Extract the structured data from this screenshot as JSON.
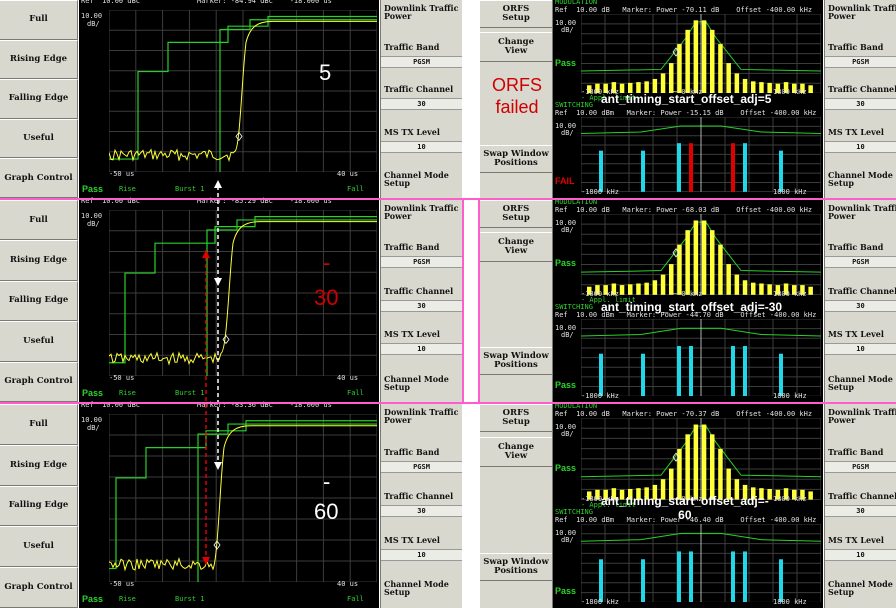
{
  "left": {
    "panels": [
      {
        "buttons": [
          "Full",
          "Rising Edge",
          "Falling Edge",
          "Useful",
          "Graph Control"
        ],
        "ref": "Ref  10.00 dBc",
        "marker": "Marker: -84.94 dBc    -18.000 us",
        "scale": "10.00",
        "scale_unit": "dB/",
        "x_left": "-50 us",
        "x_right": "40 us",
        "footer_pass": "Pass",
        "footer_rise": "Rise",
        "footer_burst": "Burst 1",
        "footer_fall": "Fall",
        "annotation": "5",
        "right_labels": {
          "dl_power": "Downlink Traffic\nPower",
          "traffic_band": "Traffic Band",
          "traffic_band_value": "PGSM",
          "traffic_channel": "Traffic Channel",
          "traffic_channel_value": "30",
          "ms_tx_level": "MS TX Level",
          "ms_tx_level_value": "10",
          "channel_mode": "Channel Mode\nSetup"
        }
      },
      {
        "buttons": [
          "Full",
          "Rising Edge",
          "Falling Edge",
          "Useful",
          "Graph Control"
        ],
        "ref": "Ref  10.00 dBc",
        "marker": "Marker: -85.29 dBc    -18.000 us",
        "scale": "10.00",
        "scale_unit": "dB/",
        "x_left": "-50 us",
        "x_right": "40 us",
        "footer_pass": "Pass",
        "footer_rise": "Rise",
        "footer_burst": "Burst 1",
        "footer_fall": "Fall",
        "annotation_minus": "-",
        "annotation": "30",
        "right_labels": {
          "dl_power": "Downlink Traffic\nPower",
          "traffic_band": "Traffic Band",
          "traffic_band_value": "PGSM",
          "traffic_channel": "Traffic Channel",
          "traffic_channel_value": "30",
          "ms_tx_level": "MS TX Level",
          "ms_tx_level_value": "10",
          "channel_mode": "Channel Mode\nSetup"
        }
      },
      {
        "buttons": [
          "Full",
          "Rising Edge",
          "Falling Edge",
          "Useful",
          "Graph Control"
        ],
        "ref": "Ref  10.00 dBc",
        "marker": "Marker: -83.36 dBc    -18.000 us",
        "scale": "10.00",
        "scale_unit": "dB/",
        "x_left": "-50 us",
        "x_right": "40 us",
        "footer_pass": "Pass",
        "footer_rise": "Rise",
        "footer_burst": "Burst 1",
        "footer_fall": "Fall",
        "annotation_minus": "-",
        "annotation": "60",
        "right_labels": {
          "dl_power": "Downlink Traffic\nPower",
          "traffic_band": "Traffic Band",
          "traffic_band_value": "PGSM",
          "traffic_channel": "Traffic Channel",
          "traffic_channel_value": "30",
          "ms_tx_level": "MS TX Level",
          "ms_tx_level_value": "10",
          "channel_mode": "Channel Mode\nSetup"
        }
      }
    ]
  },
  "right": {
    "orfs_failed": "ORFS\nfailed",
    "panels": [
      {
        "buttons": [
          "ORFS\nSetup",
          "Change\nView",
          "Swap Window\nPositions"
        ],
        "mod_title": "MODULATION",
        "mod_hdr": "Ref  10.00 dB   Marker: Power -70.11 dB    Offset -400.00 kHz",
        "mod_scale": "10.00",
        "mod_unit": "dB/",
        "mod_limit": "- Appl. limit",
        "mod_x_left": "-1800 kHz",
        "mod_x_mid": "~ 0 kHz",
        "mod_x_right": "1800 kHz",
        "sw_title": "SWITCHING",
        "sw_hdr": "Ref  10.00 dBm   Marker: Power -15.15 dB    Offset -400.00 kHz",
        "sw_scale": "10.00",
        "sw_unit": "dB/",
        "sw_x_left": "-1800 kHz",
        "sw_x_right": "1800 kHz",
        "pass": "Pass",
        "sw_status": "FAIL",
        "overlay": "ant_timing_start_offset_adj=5",
        "right_labels": {
          "dl_power": "Downlink Traffic\nPower",
          "traffic_band": "Traffic Band",
          "traffic_band_value": "PGSM",
          "traffic_channel": "Traffic Channel",
          "traffic_channel_value": "30",
          "ms_tx_level": "MS TX Level",
          "ms_tx_level_value": "10",
          "channel_mode": "Channel Mode\nSetup"
        }
      },
      {
        "buttons": [
          "ORFS\nSetup",
          "Change\nView",
          "Swap Window\nPositions"
        ],
        "mod_title": "MODULATION",
        "mod_hdr": "Ref  10.00 dB   Marker: Power -68.03 dB    Offset -400.00 kHz",
        "mod_scale": "10.00",
        "mod_unit": "dB/",
        "mod_limit": "- Appl. limit",
        "mod_x_left": "-1800 kHz",
        "mod_x_mid": "~ 0 kHz",
        "mod_x_right": "1800 kHz",
        "sw_title": "SWITCHING",
        "sw_hdr": "Ref  10.00 dBm   Marker: Power -44.70 dB    Offset -400.00 kHz",
        "sw_scale": "10.00",
        "sw_unit": "dB/",
        "sw_x_left": "-1800 kHz",
        "sw_x_right": "1800 kHz",
        "pass": "Pass",
        "sw_status": "Pass",
        "overlay": "ant_timing_start_offset_adj=-30",
        "right_labels": {
          "dl_power": "Downlink Traffic\nPower",
          "traffic_band": "Traffic Band",
          "traffic_band_value": "PGSM",
          "traffic_channel": "Traffic Channel",
          "traffic_channel_value": "30",
          "ms_tx_level": "MS TX Level",
          "ms_tx_level_value": "10",
          "channel_mode": "Channel Mode\nSetup"
        }
      },
      {
        "buttons": [
          "ORFS\nSetup",
          "Change\nView",
          "Swap Window\nPositions"
        ],
        "mod_title": "MODULATION",
        "mod_hdr": "Ref  10.00 dB   Marker: Power -70.37 dB    Offset -400.00 kHz",
        "mod_scale": "10.00",
        "mod_unit": "dB/",
        "mod_limit": "- Appl. limit",
        "mod_x_left": "-1800 kHz",
        "mod_x_mid": "~ 0 kHz",
        "mod_x_right": "1800 kHz",
        "sw_title": "SWITCHING",
        "sw_hdr": "Ref  10.00 dBm   Marker: Power -46.40 dB    Offset -400.00 kHz",
        "sw_scale": "10.00",
        "sw_unit": "dB/",
        "sw_x_left": "-1800 kHz",
        "sw_x_right": "1800 kHz",
        "pass": "Pass",
        "sw_status": "Pass",
        "overlay": "ant_timing_start_offset_adj=-\n60",
        "right_labels": {
          "dl_power": "Downlink Traffic\nPower",
          "traffic_band": "Traffic Band",
          "traffic_band_value": "PGSM",
          "traffic_channel": "Traffic Channel",
          "traffic_channel_value": "30",
          "ms_tx_level": "MS TX Level",
          "ms_tx_level_value": "10",
          "channel_mode": "Channel Mode\nSetup"
        }
      }
    ]
  },
  "colors": {
    "screen_bg": "#000000",
    "grid": "#3c3c3c",
    "limit_green": "#29d029",
    "trace_yellow": "#ffff3a",
    "pass_green": "#2bd22b",
    "fail_red": "#e00000",
    "switching_cyan": "#21d8e8",
    "separator_pink": "#ff5ccd",
    "button_gray": "#d8d8cf"
  }
}
